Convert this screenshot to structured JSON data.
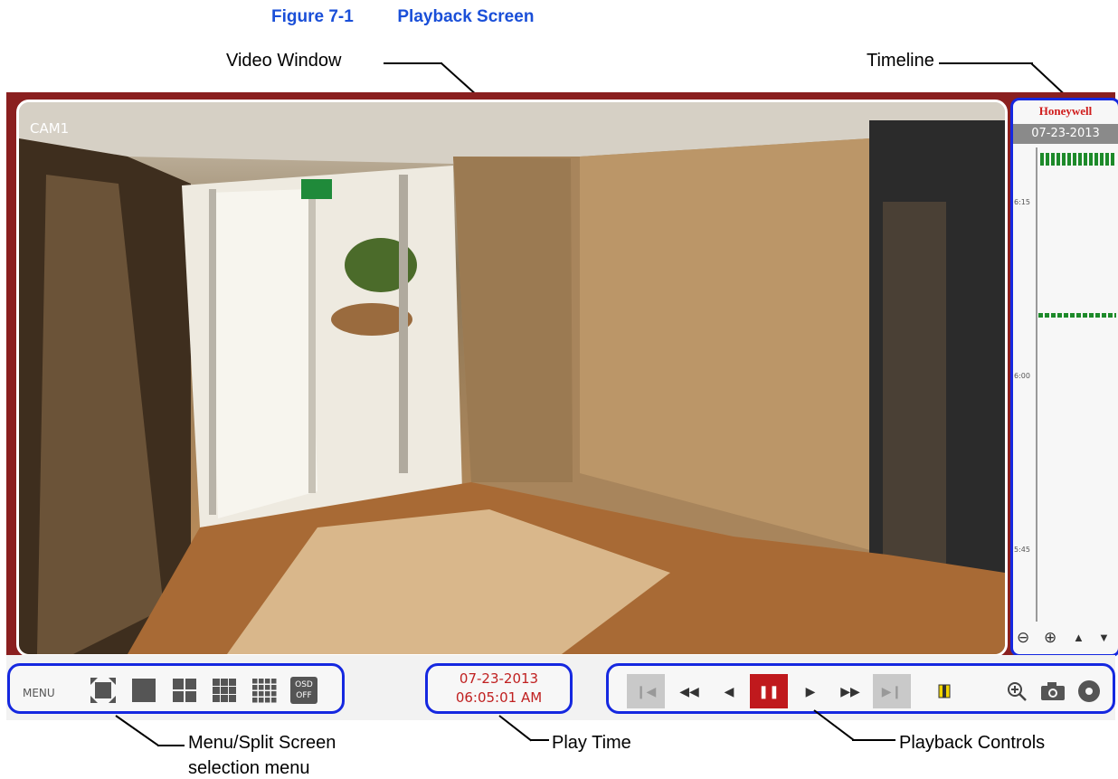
{
  "figure": {
    "number": "Figure 7-1",
    "title": "Playback Screen"
  },
  "callouts": {
    "video_window": "Video Window",
    "timeline": "Timeline",
    "menu_split_line1": "Menu/Split Screen",
    "menu_split_line2": "selection menu",
    "play_time": "Play Time",
    "playback_controls": "Playback Controls"
  },
  "video": {
    "camera_label": "CAM1"
  },
  "timeline": {
    "brand": "Honeywell",
    "date": "07-23-2013",
    "ticks": [
      "6:15",
      "6:00",
      "5:45"
    ],
    "controls": {
      "zoom_out_icon": "zoom-out-icon",
      "zoom_in_icon": "zoom-in-icon",
      "up_icon": "triangle-up-icon",
      "down_icon": "triangle-down-icon"
    }
  },
  "menu_bar": {
    "menu_label": "MENU",
    "split_options": [
      "fullscreen",
      "1-split",
      "4-split",
      "9-split",
      "16-split"
    ],
    "osd_line1": "OSD",
    "osd_line2": "OFF"
  },
  "play_time": {
    "date": "07-23-2013",
    "time": "06:05:01 AM"
  },
  "playback": {
    "buttons": [
      {
        "name": "step-back",
        "glyph": "⏮",
        "state": "disabled"
      },
      {
        "name": "fast-rewind",
        "glyph": "◀◀",
        "state": "normal"
      },
      {
        "name": "reverse-play",
        "glyph": "◀",
        "state": "normal"
      },
      {
        "name": "pause",
        "glyph": "❚❚",
        "state": "active"
      },
      {
        "name": "play",
        "glyph": "▶",
        "state": "normal"
      },
      {
        "name": "fast-forward",
        "glyph": "▶▶",
        "state": "normal"
      },
      {
        "name": "step-forward",
        "glyph": "⏭",
        "state": "disabled"
      }
    ],
    "colors": {
      "active": "#c0191d",
      "disabled": "#c9c9c9",
      "highlight": "#1528e0",
      "playtime_text": "#c02020"
    }
  }
}
